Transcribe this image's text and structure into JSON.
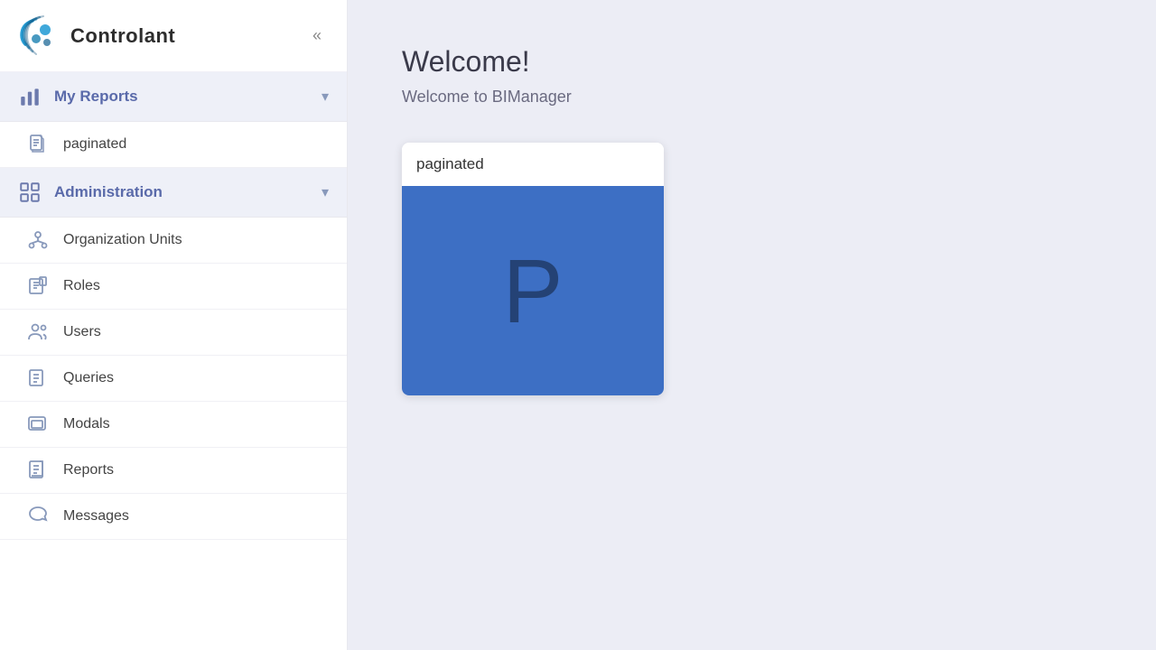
{
  "app": {
    "title": "Controlant",
    "collapse_icon": "«"
  },
  "sidebar": {
    "my_reports": {
      "label": "My Reports",
      "expanded": true,
      "items": [
        {
          "id": "paginated",
          "label": "paginated"
        }
      ]
    },
    "administration": {
      "label": "Administration",
      "expanded": true,
      "items": [
        {
          "id": "organization-units",
          "label": "Organization Units"
        },
        {
          "id": "roles",
          "label": "Roles"
        },
        {
          "id": "users",
          "label": "Users"
        },
        {
          "id": "queries",
          "label": "Queries"
        },
        {
          "id": "modals",
          "label": "Modals"
        },
        {
          "id": "reports",
          "label": "Reports"
        },
        {
          "id": "messages",
          "label": "Messages"
        }
      ]
    }
  },
  "main": {
    "welcome_title": "Welcome!",
    "welcome_subtitle": "Welcome to BIManager",
    "card": {
      "title": "paginated",
      "letter": "P",
      "color": "#3d6fc4"
    }
  }
}
